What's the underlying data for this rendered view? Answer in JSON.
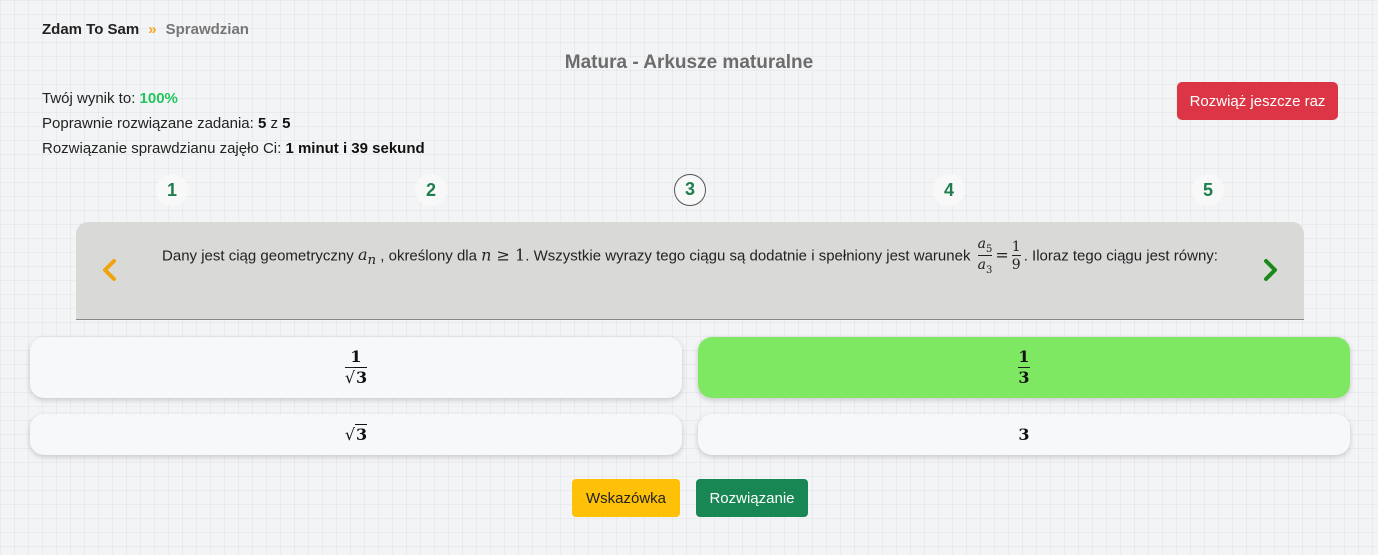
{
  "breadcrumb": {
    "home": "Zdam To Sam",
    "separator": "»",
    "current": "Sprawdzian"
  },
  "page_title": "Matura - Arkusze maturalne",
  "results": {
    "score_label": "Twój wynik to: ",
    "score_value": "100%",
    "correct_label": "Poprawnie rozwiązane zadania: ",
    "correct_count": "5",
    "correct_of": " z ",
    "correct_total": "5",
    "time_label": "Rozwiązanie sprawdzianu zajęło Ci: ",
    "time_value": "1 minut i 39 sekund"
  },
  "retry_button": "Rozwiąż jeszcze raz",
  "questions": [
    "1",
    "2",
    "3",
    "4",
    "5"
  ],
  "active_question": "3",
  "question": {
    "part1": "Dany jest ciąg geometryczny ",
    "var_a": "a",
    "var_n_sub": "n",
    "part2": " , określony dla ",
    "cond_n": "n",
    "cond_rel": " ≥ 1",
    "part3": ". Wszystkie wyrazy tego ciągu są dodatnie i spełniony jest warunek ",
    "frac_num_var": "a",
    "frac_num_sub": "5",
    "frac_den_var": "a",
    "frac_den_sub": "3",
    "equals": "=",
    "rhs_num": "1",
    "rhs_den": "9",
    "part4": ". Iloraz tego ciągu jest równy:"
  },
  "answers": [
    {
      "num": "1",
      "den": "3",
      "correct": false
    },
    {
      "num": "1",
      "den": "3",
      "correct": true
    },
    {
      "value": "3",
      "correct": false
    },
    {
      "value": "3",
      "correct": false
    }
  ],
  "hint_button": "Wskazówka",
  "solution_button": "Rozwiązanie",
  "colors": {
    "correct_answer": "#7fe862",
    "score": "#22c55e",
    "retry": "#dc3545",
    "hint": "#ffc107",
    "solution": "#198754",
    "prev_arrow": "#f0a30a",
    "next_arrow": "#1a8a1a"
  },
  "icons": {
    "prev": "chevron-left-icon",
    "next": "chevron-right-icon",
    "separator": "double-chevron-icon"
  }
}
